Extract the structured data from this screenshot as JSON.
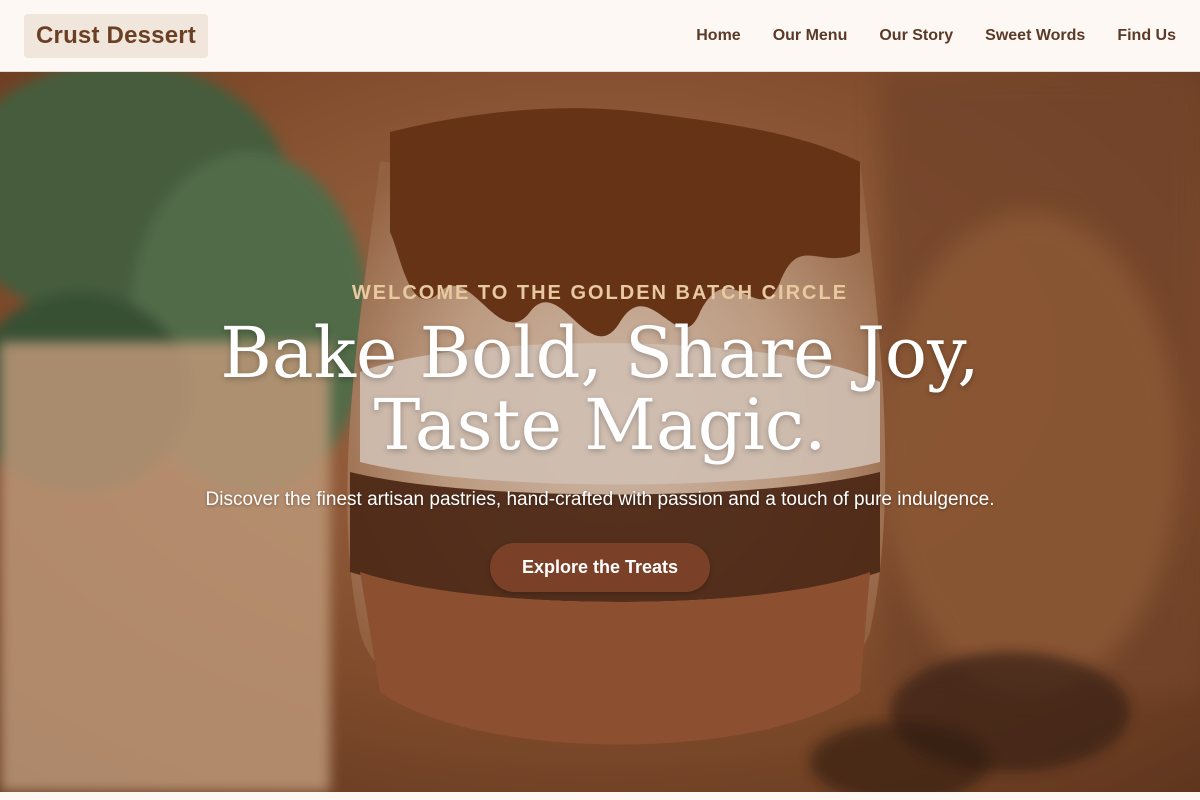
{
  "brand": {
    "name": "Crust Dessert"
  },
  "nav": {
    "items": [
      {
        "label": "Home"
      },
      {
        "label": "Our Menu"
      },
      {
        "label": "Our Story"
      },
      {
        "label": "Sweet Words"
      },
      {
        "label": "Find Us"
      }
    ]
  },
  "hero": {
    "eyebrow": "WELCOME TO THE GOLDEN BATCH CIRCLE",
    "headline_line1": "Bake Bold, Share Joy,",
    "headline_line2": "Taste Magic.",
    "subtitle": "Discover the finest artisan pastries, hand-crafted with passion and a touch of pure indulgence.",
    "cta_label": "Explore the Treats"
  },
  "colors": {
    "nav_bg": "#fdf8f4",
    "brand_text": "#6b3f24",
    "nav_text": "#5a3a26",
    "eyebrow": "#e8c9a0",
    "cta_bg": "#7a4128"
  }
}
